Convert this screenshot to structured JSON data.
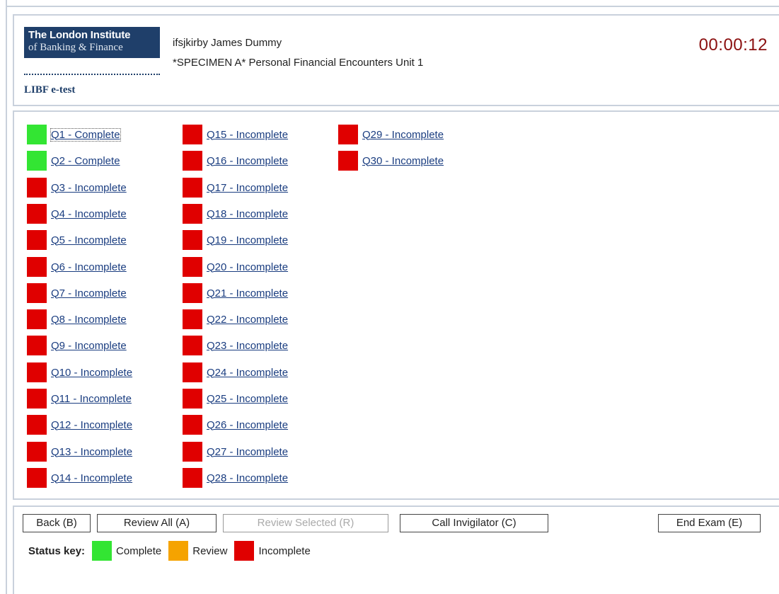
{
  "header": {
    "logo_line1": "The London Institute",
    "logo_line2": "of Banking & Finance",
    "product_name": "LIBF e-test",
    "candidate": "ifsjkirby James Dummy",
    "exam_title": "*SPECIMEN A* Personal Financial Encounters Unit 1",
    "timer": "00:00:12"
  },
  "colors": {
    "complete": "#33e533",
    "review": "#f5a300",
    "incomplete": "#e00000",
    "brand_navy": "#1f3f6a",
    "timer": "#8b1010"
  },
  "questions": [
    {
      "label": "Q1 - Complete",
      "status": "complete"
    },
    {
      "label": "Q2 - Complete",
      "status": "complete"
    },
    {
      "label": "Q3 - Incomplete",
      "status": "incomplete"
    },
    {
      "label": "Q4 - Incomplete",
      "status": "incomplete"
    },
    {
      "label": "Q5 - Incomplete",
      "status": "incomplete"
    },
    {
      "label": "Q6 - Incomplete",
      "status": "incomplete"
    },
    {
      "label": "Q7 - Incomplete",
      "status": "incomplete"
    },
    {
      "label": "Q8 - Incomplete",
      "status": "incomplete"
    },
    {
      "label": "Q9 - Incomplete",
      "status": "incomplete"
    },
    {
      "label": "Q10 - Incomplete",
      "status": "incomplete"
    },
    {
      "label": "Q11 - Incomplete",
      "status": "incomplete"
    },
    {
      "label": "Q12 - Incomplete",
      "status": "incomplete"
    },
    {
      "label": "Q13 - Incomplete",
      "status": "incomplete"
    },
    {
      "label": "Q14 - Incomplete",
      "status": "incomplete"
    },
    {
      "label": "Q15 - Incomplete",
      "status": "incomplete"
    },
    {
      "label": "Q16 - Incomplete",
      "status": "incomplete"
    },
    {
      "label": "Q17 - Incomplete",
      "status": "incomplete"
    },
    {
      "label": "Q18 - Incomplete",
      "status": "incomplete"
    },
    {
      "label": "Q19 - Incomplete",
      "status": "incomplete"
    },
    {
      "label": "Q20 - Incomplete",
      "status": "incomplete"
    },
    {
      "label": "Q21 - Incomplete",
      "status": "incomplete"
    },
    {
      "label": "Q22 - Incomplete",
      "status": "incomplete"
    },
    {
      "label": "Q23 - Incomplete",
      "status": "incomplete"
    },
    {
      "label": "Q24 - Incomplete",
      "status": "incomplete"
    },
    {
      "label": "Q25 - Incomplete",
      "status": "incomplete"
    },
    {
      "label": "Q26 - Incomplete",
      "status": "incomplete"
    },
    {
      "label": "Q27 - Incomplete",
      "status": "incomplete"
    },
    {
      "label": "Q28 - Incomplete",
      "status": "incomplete"
    },
    {
      "label": "Q29 - Incomplete",
      "status": "incomplete"
    },
    {
      "label": "Q30 - Incomplete",
      "status": "incomplete"
    }
  ],
  "footer": {
    "back_label": "Back (B)",
    "review_all_label": "Review All (A)",
    "review_selected_label": "Review Selected (R)",
    "call_invigilator_label": "Call Invigilator (C)",
    "end_exam_label": "End Exam (E)",
    "status_key_label": "Status key:",
    "key_complete": "Complete",
    "key_review": "Review",
    "key_incomplete": "Incomplete"
  }
}
